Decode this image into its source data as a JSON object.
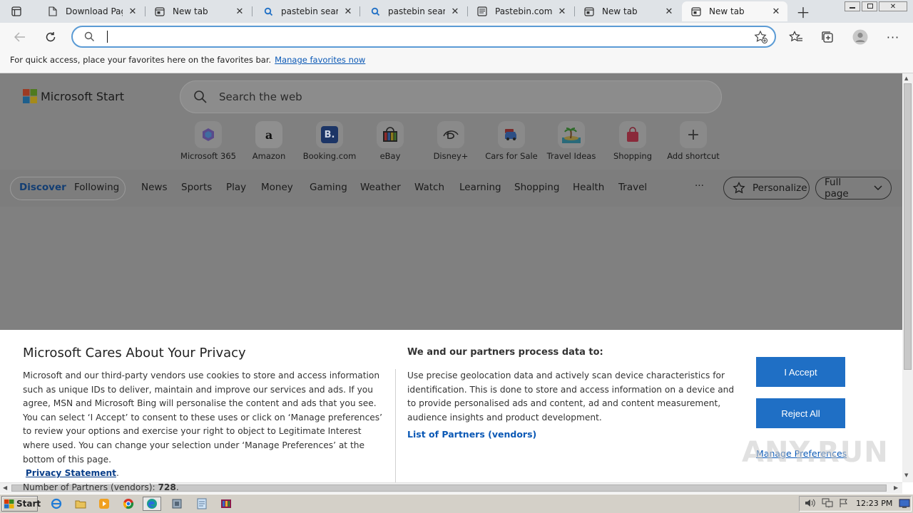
{
  "tabs": [
    {
      "label": "Download Pag",
      "icon": "document-icon"
    },
    {
      "label": "New tab",
      "icon": "newtab-icon"
    },
    {
      "label": "pastebin searc",
      "icon": "search-icon"
    },
    {
      "label": "pastebin searc",
      "icon": "search-icon"
    },
    {
      "label": "Pastebin.com",
      "icon": "pastebin-icon"
    },
    {
      "label": "New tab",
      "icon": "newtab-icon"
    },
    {
      "label": "New tab",
      "icon": "newtab-icon",
      "active": true
    }
  ],
  "address_bar": {
    "value": ""
  },
  "favorites_bar": {
    "text": "For quick access, place your favorites here on the favorites bar.",
    "link": "Manage favorites now"
  },
  "start_page": {
    "brand": "Microsoft Start",
    "search_placeholder": "Search the web",
    "shortcuts": [
      {
        "label": "Microsoft 365",
        "icon": "microsoft365-icon"
      },
      {
        "label": "Amazon",
        "icon": "amazon-icon"
      },
      {
        "label": "Booking.com",
        "icon": "booking-icon"
      },
      {
        "label": "eBay",
        "icon": "ebay-icon"
      },
      {
        "label": "Disney+",
        "icon": "disney-icon"
      },
      {
        "label": "Cars for Sale",
        "icon": "car-icon"
      },
      {
        "label": "Travel Ideas",
        "icon": "island-icon"
      },
      {
        "label": "Shopping",
        "icon": "shopping-bag-icon"
      },
      {
        "label": "Add shortcut",
        "icon": "plus-icon"
      }
    ],
    "nav": {
      "discover": "Discover",
      "following": "Following",
      "items": [
        "News",
        "Sports",
        "Play",
        "Money",
        "Gaming",
        "Weather",
        "Watch",
        "Learning",
        "Shopping",
        "Health",
        "Travel"
      ],
      "more": "···",
      "personalize": "Personalize",
      "layout": "Full page"
    }
  },
  "cookie_dialog": {
    "title": "Microsoft Cares About Your Privacy",
    "body": "Microsoft and our third-party vendors use cookies to store and access information such as unique IDs to deliver, maintain and improve our services and ads. If you agree, MSN and Microsoft Bing will personalise the content and ads that you see. You can select ‘I Accept’ to consent to these uses or click on ‘Manage preferences’ to review your options and exercise your right to object to Legitimate Interest where used.  You can change your selection under ‘Manage Preferences’ at the bottom of this page.",
    "privacy_link": "Privacy Statement",
    "partners_label": "Number of Partners (vendors):",
    "partners_count": "728",
    "purpose_heading": "We and our partners process data to:",
    "purpose_body": "Use precise geolocation data and actively scan device characteristics for identification. This is done to store and access information on a device and to provide personalised ads and content, ad and content measurement, audience insights and product development.",
    "partners_link": "List of Partners (vendors)",
    "accept": "I Accept",
    "reject": "Reject All",
    "manage": "Manage Preferences"
  },
  "taskbar": {
    "start": "Start",
    "clock": "12:23 PM"
  },
  "watermark": "ANY.RUN",
  "colors": {
    "accent": "#1f6fc5",
    "link": "#0a58b5",
    "overlay": "#808080"
  }
}
